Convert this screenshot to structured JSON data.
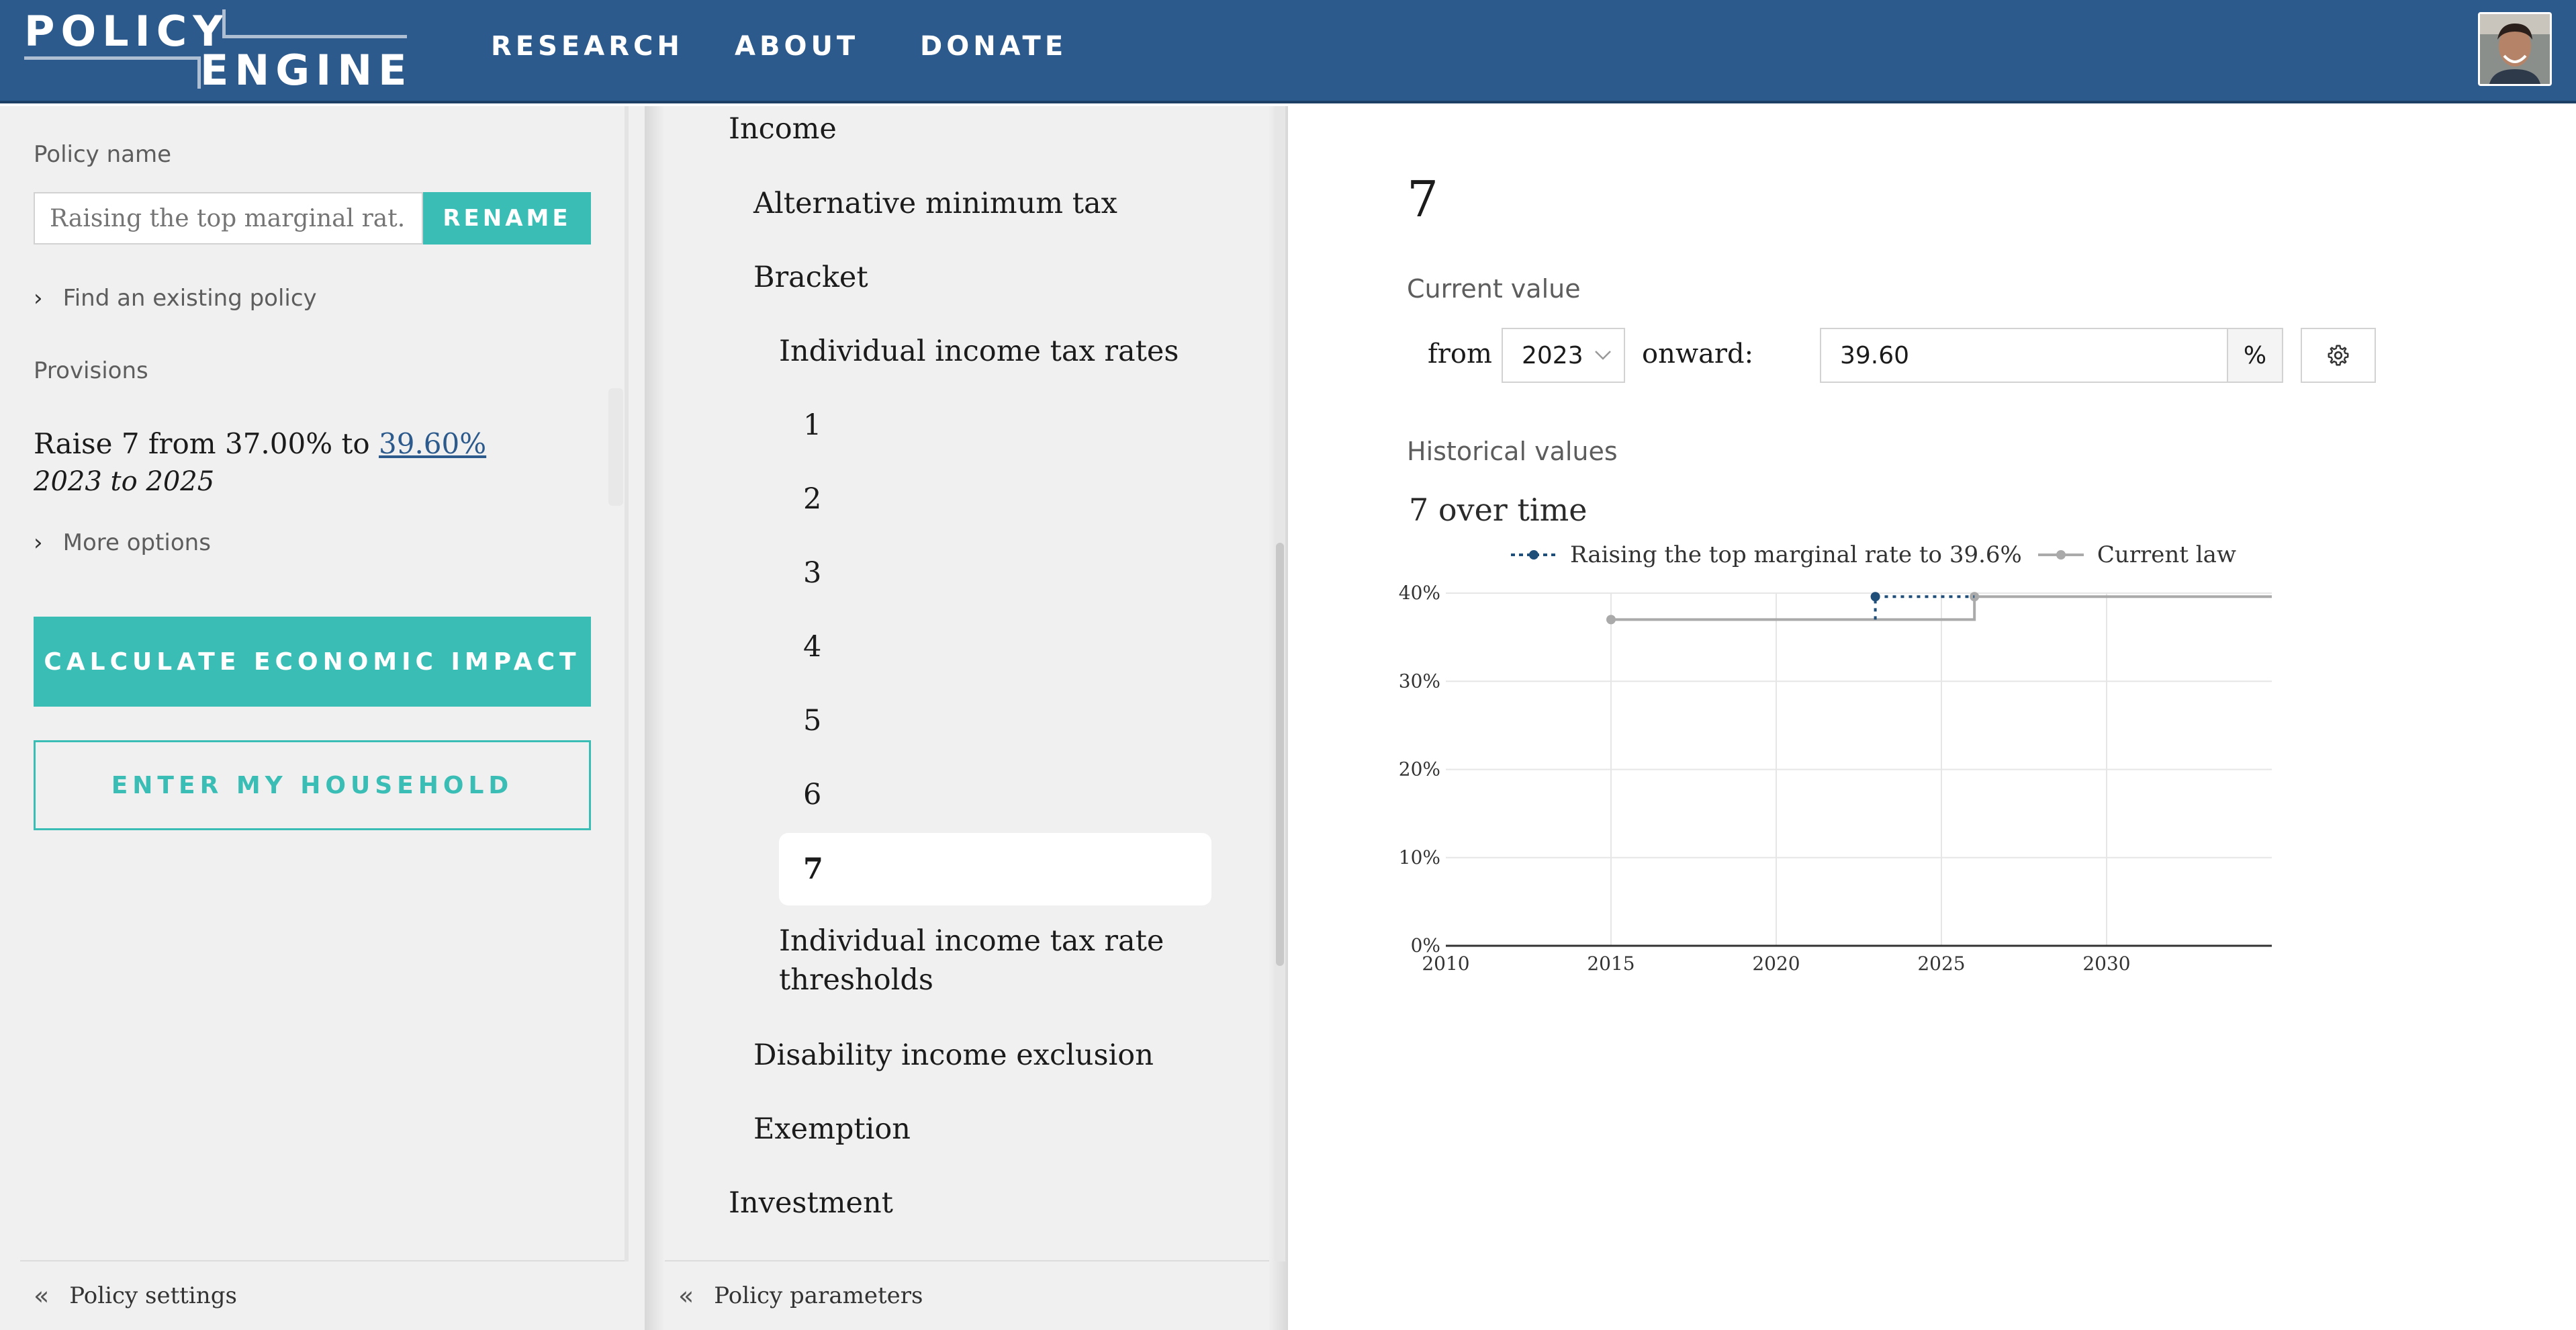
{
  "header": {
    "logo_line1": "POLICY",
    "logo_line2": "ENGINE",
    "nav": [
      "RESEARCH",
      "ABOUT",
      "DONATE"
    ]
  },
  "left_panel": {
    "policy_name_label": "Policy name",
    "policy_name_placeholder": "Raising the top marginal rat...",
    "rename_label": "RENAME",
    "find_policy_label": "Find an existing policy",
    "provisions_label": "Provisions",
    "provision": {
      "text_prefix": "Raise 7 from 37.00% to",
      "new_value": "39.60%",
      "years": "2023 to 2025"
    },
    "more_options_label": "More options",
    "calculate_label": "CALCULATE ECONOMIC IMPACT",
    "household_label": "ENTER MY HOUSEHOLD",
    "footer_label": "Policy settings"
  },
  "middle_panel": {
    "tree": [
      {
        "label": "Income",
        "level": 0
      },
      {
        "label": "Alternative minimum tax",
        "level": 1
      },
      {
        "label": "Bracket",
        "level": 1
      },
      {
        "label": "Individual income tax rates",
        "level": 2
      },
      {
        "label": "1",
        "level": 3
      },
      {
        "label": "2",
        "level": 3
      },
      {
        "label": "3",
        "level": 3
      },
      {
        "label": "4",
        "level": 3
      },
      {
        "label": "5",
        "level": 3
      },
      {
        "label": "6",
        "level": 3
      },
      {
        "label": "7",
        "level": 3,
        "selected": true
      },
      {
        "label": "Individual income tax rate thresholds",
        "level": 2
      },
      {
        "label": "Disability income exclusion",
        "level": 1
      },
      {
        "label": "Exemption",
        "level": 1
      },
      {
        "label": "Investment",
        "level": 0
      }
    ],
    "footer_label": "Policy parameters"
  },
  "right_panel": {
    "title": "7",
    "current_value_label": "Current value",
    "from_label": "from",
    "from_year": "2023",
    "onward_label": "onward:",
    "value": "39.60",
    "unit": "%",
    "historical_label": "Historical values"
  },
  "chart_data": {
    "type": "line",
    "title": "7 over time",
    "series": [
      {
        "name": "Raising the top marginal rate to 39.6%",
        "color": "#1f4e79",
        "style": "dotted",
        "points": [
          [
            2023,
            37.0
          ],
          [
            2023,
            39.6
          ],
          [
            2026,
            39.6
          ]
        ]
      },
      {
        "name": "Current law",
        "color": "#aaaaaa",
        "style": "solid",
        "points": [
          [
            2015,
            37.0
          ],
          [
            2026,
            37.0
          ],
          [
            2026,
            39.6
          ],
          [
            2035,
            39.6
          ]
        ]
      }
    ],
    "x_ticks": [
      2010,
      2015,
      2020,
      2025,
      2030
    ],
    "y_ticks": [
      "0%",
      "10%",
      "20%",
      "30%",
      "40%"
    ],
    "xlim": [
      2010,
      2035
    ],
    "ylim": [
      0,
      40
    ],
    "grid": true,
    "legend_position": "top"
  }
}
